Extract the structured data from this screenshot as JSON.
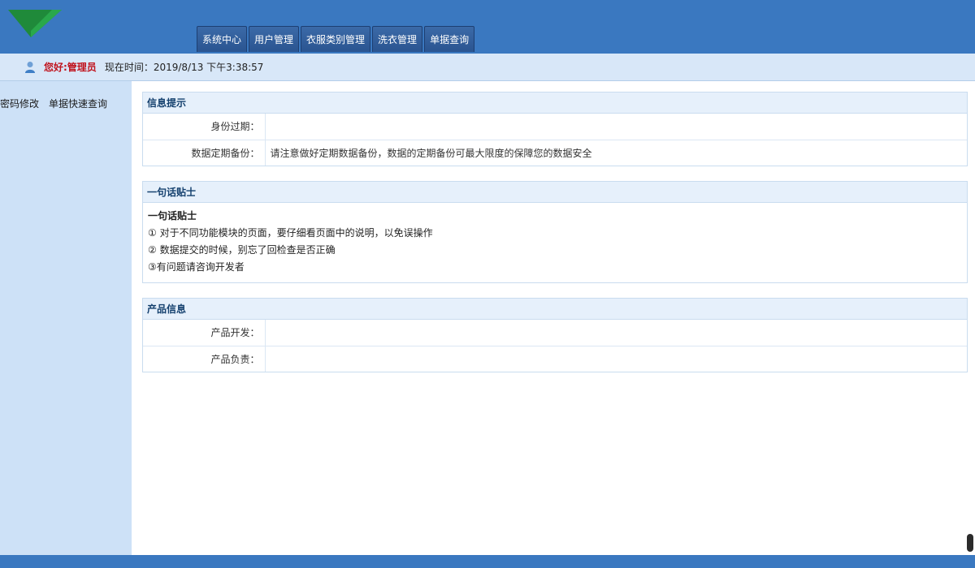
{
  "nav": {
    "tabs": [
      {
        "label": "系统中心"
      },
      {
        "label": "用户管理"
      },
      {
        "label": "衣服类别管理"
      },
      {
        "label": "洗衣管理"
      },
      {
        "label": "单据查询"
      }
    ]
  },
  "infobar": {
    "greeting": "您好:管理员",
    "time_label": "现在时间：2019/8/13 下午3:38:57"
  },
  "sidebar": {
    "links": [
      {
        "label": "密码修改"
      },
      {
        "label": "单据快速查询"
      }
    ]
  },
  "panels": {
    "info": {
      "title": "信息提示",
      "rows": [
        {
          "key": "身份过期：",
          "value": ""
        },
        {
          "key": "数据定期备份：",
          "value": "请注意做好定期数据备份，数据的定期备份可最大限度的保障您的数据安全"
        }
      ]
    },
    "tips": {
      "title": "一句话贴士",
      "heading": "一句话贴士",
      "items": [
        "① 对于不同功能模块的页面，要仔细看页面中的说明，以免误操作",
        "② 数据提交的时候，别忘了回检查是否正确",
        "③有问题请咨询开发者"
      ]
    },
    "product": {
      "title": "产品信息",
      "rows": [
        {
          "key": "产品开发：",
          "value": ""
        },
        {
          "key": "产品负责：",
          "value": ""
        }
      ]
    }
  },
  "colors": {
    "header_blue": "#3a78c0",
    "sidebar_bg": "#cde1f7",
    "greeting_red": "#c0141e",
    "panel_title_text": "#14406e"
  },
  "icons": {
    "logo": "green-triangle-logo-icon",
    "user": "user-icon"
  }
}
